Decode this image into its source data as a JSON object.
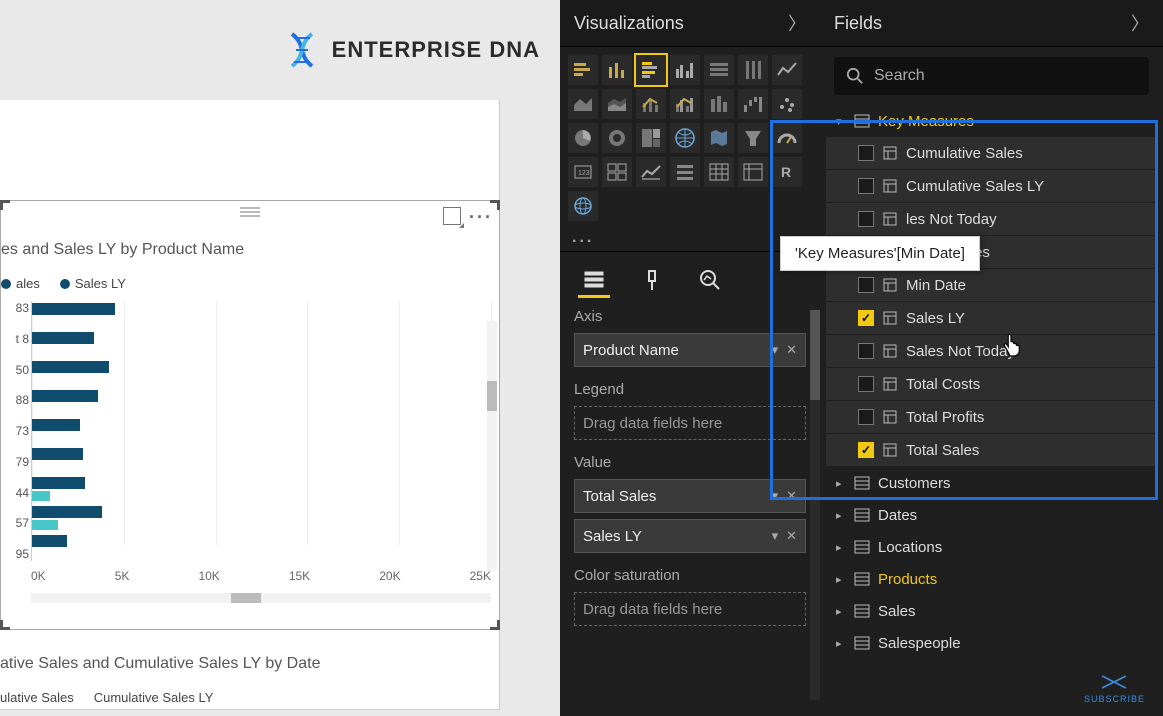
{
  "brand": {
    "name": "ENTERPRISE DNA"
  },
  "chart1": {
    "title": "es and Sales LY by Product Name",
    "legend": [
      {
        "label": "ales",
        "color": "#0f4c6e"
      },
      {
        "label": "Sales LY",
        "color": "#0f4c6e"
      }
    ]
  },
  "chart_data": {
    "type": "bar",
    "orientation": "horizontal",
    "x_ticks": [
      "0K",
      "5K",
      "10K",
      "15K",
      "20K",
      "25K"
    ],
    "xlim": [
      0,
      25000
    ],
    "series": [
      {
        "name": "Total Sales",
        "color": "#0f4c6e"
      },
      {
        "name": "Sales LY",
        "color": "#47c7c7"
      }
    ],
    "rows": [
      {
        "label_fragment": "83",
        "total_sales": 4500,
        "sales_ly": 0
      },
      {
        "label_fragment": "t 8",
        "total_sales": 3400,
        "sales_ly": 0
      },
      {
        "label_fragment": "50",
        "total_sales": 4200,
        "sales_ly": 0
      },
      {
        "label_fragment": "88",
        "total_sales": 3600,
        "sales_ly": 0
      },
      {
        "label_fragment": "73",
        "total_sales": 2600,
        "sales_ly": 0
      },
      {
        "label_fragment": "79",
        "total_sales": 2800,
        "sales_ly": 0
      },
      {
        "label_fragment": "44",
        "total_sales": 2900,
        "sales_ly": 1000
      },
      {
        "label_fragment": "57",
        "total_sales": 3800,
        "sales_ly": 1400
      },
      {
        "label_fragment": "95",
        "total_sales": 1900,
        "sales_ly": 0
      }
    ]
  },
  "chart2": {
    "title": "ative Sales and Cumulative Sales LY by Date",
    "legend": [
      {
        "label": "ulative Sales",
        "color": "#0f4c6e"
      },
      {
        "label": "Cumulative Sales LY",
        "color": "#47c7c7"
      }
    ]
  },
  "viz_pane": {
    "title": "Visualizations",
    "more": "...",
    "wells": {
      "axis": {
        "label": "Axis",
        "items": [
          "Product Name"
        ]
      },
      "legend": {
        "label": "Legend",
        "placeholder": "Drag data fields here"
      },
      "value": {
        "label": "Value",
        "items": [
          "Total Sales",
          "Sales LY"
        ]
      },
      "colorsat": {
        "label": "Color saturation",
        "placeholder": "Drag data fields here"
      }
    }
  },
  "fields_pane": {
    "title": "Fields",
    "search_placeholder": "Search",
    "tables": [
      {
        "name": "Key Measures",
        "expanded": true,
        "highlighted": true,
        "fields": [
          {
            "name": "Cumulative Sales",
            "checked": false
          },
          {
            "name": "Cumulative Sales LY",
            "checked": false
          },
          {
            "name": "Cumulative Sales Not Today",
            "checked": false,
            "truncated": "les Not Today"
          },
          {
            "name": "Diff. in Sales",
            "checked": false,
            "obscured": true
          },
          {
            "name": "Min Date",
            "checked": false
          },
          {
            "name": "Sales LY",
            "checked": true
          },
          {
            "name": "Sales Not Today",
            "checked": false
          },
          {
            "name": "Total Costs",
            "checked": false
          },
          {
            "name": "Total Profits",
            "checked": false
          },
          {
            "name": "Total Sales",
            "checked": true
          }
        ]
      },
      {
        "name": "Customers",
        "expanded": false
      },
      {
        "name": "Dates",
        "expanded": false
      },
      {
        "name": "Locations",
        "expanded": false
      },
      {
        "name": "Products",
        "expanded": false,
        "highlighted": true
      },
      {
        "name": "Sales",
        "expanded": false
      },
      {
        "name": "Salespeople",
        "expanded": false
      }
    ]
  },
  "tooltip": {
    "text": "'Key Measures'[Min Date]"
  },
  "subscribe": {
    "label": "SUBSCRIBE"
  }
}
